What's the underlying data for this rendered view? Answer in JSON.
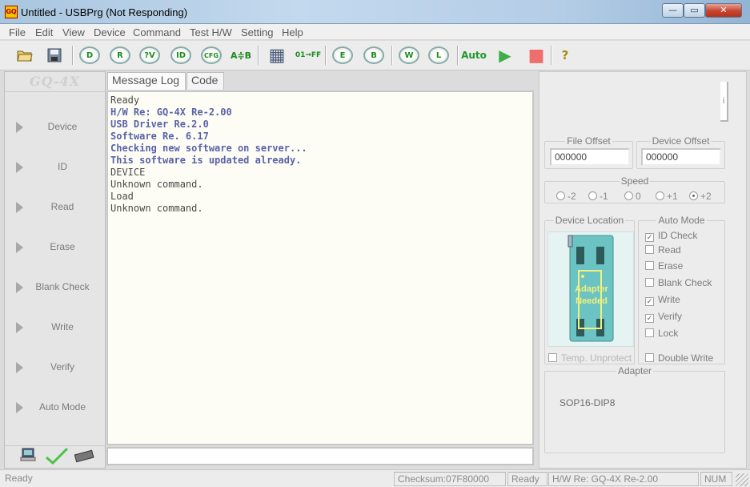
{
  "window": {
    "title": "Untitled - USBPrg (Not Responding)",
    "app_icon_text": "GQ",
    "minimize": "—",
    "maximize": "▭",
    "close": "✕"
  },
  "menu": [
    "File",
    "Edit",
    "View",
    "Device",
    "Command",
    "Test H/W",
    "Setting",
    "Help"
  ],
  "toolbar": {
    "buttons": [
      {
        "name": "open-file-button",
        "glyph": "📂"
      },
      {
        "name": "save-file-button",
        "glyph": "💾"
      },
      {
        "name": "toolbar-device-button",
        "glyph": "D"
      },
      {
        "name": "toolbar-read-button",
        "glyph": "R"
      },
      {
        "name": "toolbar-verify-button",
        "glyph": "?V"
      },
      {
        "name": "toolbar-id-button",
        "glyph": "ID"
      },
      {
        "name": "toolbar-cfg-button",
        "glyph": "CFG"
      },
      {
        "name": "toolbar-compare-button",
        "glyph": "A≑B"
      },
      {
        "name": "toolbar-hex-view-button",
        "glyph": "▦"
      },
      {
        "name": "toolbar-fill-button",
        "glyph": "01→FF"
      },
      {
        "name": "toolbar-erase-button",
        "glyph": "E"
      },
      {
        "name": "toolbar-blank-check-button",
        "glyph": "B"
      },
      {
        "name": "toolbar-write-button",
        "glyph": "W"
      },
      {
        "name": "toolbar-lock-button",
        "glyph": "L"
      },
      {
        "name": "toolbar-auto-button",
        "glyph": "Auto"
      },
      {
        "name": "toolbar-run-button",
        "glyph": "▶"
      },
      {
        "name": "toolbar-stop-button",
        "glyph": "■"
      },
      {
        "name": "toolbar-help-button",
        "glyph": "?"
      }
    ]
  },
  "left_panel": {
    "logo": "GQ-4X",
    "operations": [
      "Device",
      "ID",
      "Read",
      "Erase",
      "Blank Check",
      "Write",
      "Verify",
      "Auto Mode"
    ]
  },
  "tabs": [
    "Message Log",
    "Code"
  ],
  "log": [
    {
      "text": "Ready",
      "style": "gray"
    },
    {
      "text": "H/W Re: GQ-4X Re-2.00",
      "style": "blue"
    },
    {
      "text": "USB Driver Re.2.0",
      "style": "blue"
    },
    {
      "text": "Software Re. 6.17",
      "style": "blue"
    },
    {
      "text": "Checking new software on server...",
      "style": "blue"
    },
    {
      "text": "This software is updated already.",
      "style": "blue"
    },
    {
      "text": "DEVICE",
      "style": "gray"
    },
    {
      "text": "Unknown command.",
      "style": "gray"
    },
    {
      "text": "Load",
      "style": "gray"
    },
    {
      "text": "Unknown command.",
      "style": "gray"
    }
  ],
  "right_panel": {
    "info_glyph": "i",
    "file_offset": {
      "label": "File Offset",
      "value": "000000"
    },
    "device_offset": {
      "label": "Device Offset",
      "value": "000000"
    },
    "speed": {
      "label": "Speed",
      "options": [
        "-2",
        "-1",
        "0",
        "+1",
        "+2"
      ],
      "selected": "+2"
    },
    "device_location": {
      "label": "Device Location",
      "chip_text": [
        "Adapter",
        "Needed"
      ]
    },
    "auto_mode": {
      "label": "Auto Mode",
      "items": [
        {
          "label": "ID Check",
          "checked": true
        },
        {
          "label": "Read",
          "checked": false
        },
        {
          "label": "Erase",
          "checked": false
        },
        {
          "label": "Blank Check",
          "checked": false
        },
        {
          "label": "Write",
          "checked": true
        },
        {
          "label": "Verify",
          "checked": true
        },
        {
          "label": "Lock",
          "checked": false
        }
      ]
    },
    "temp_unprotect": "Temp. Unprotect",
    "double_write": "Double Write",
    "adapter": {
      "label": "Adapter",
      "value": "SOP16-DIP8"
    }
  },
  "statusbar": {
    "status": "Ready",
    "checksum": "Checksum:07F80000",
    "state": "Ready",
    "hw": "H/W Re: GQ-4X Re-2.00",
    "num": "NUM"
  },
  "colors": {
    "log_blue": "#5a62a8",
    "chip_teal": "#6cc3c3",
    "chip_text": "#f1f17a",
    "run_green": "#3fae49",
    "stop_red": "#f06d6d"
  }
}
